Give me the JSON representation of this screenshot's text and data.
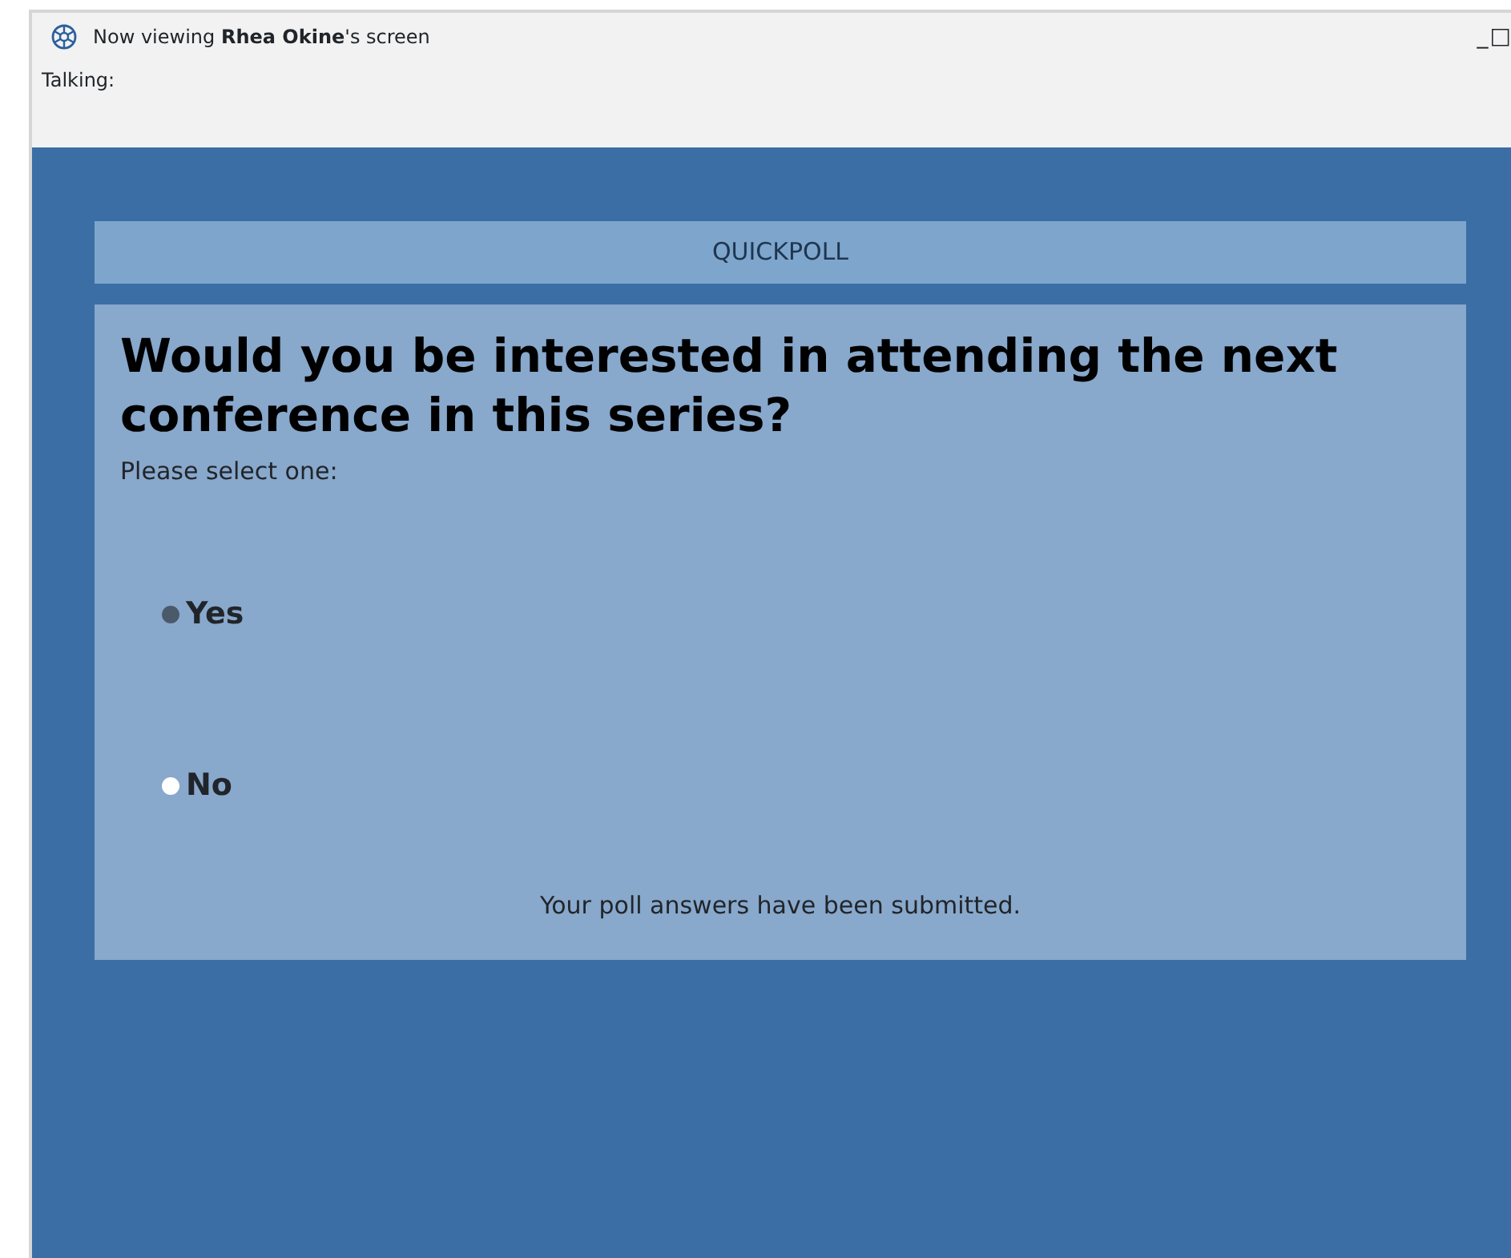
{
  "window": {
    "title": "Now viewing **Rhea  Okine**'s screen",
    "controls": [
      "_",
      "□"
    ]
  },
  "talking": {
    "label": "Talking:"
  },
  "poll": {
    "header": "QUICKPOLL",
    "question": "Would you be interested in attending the next conference in this series?",
    "instruction": "Please select one:",
    "options": [
      {
        "label": "Yes",
        "selected": true
      },
      {
        "label": "No",
        "selected": false
      }
    ],
    "status": "Your poll answers have been submitted."
  }
}
